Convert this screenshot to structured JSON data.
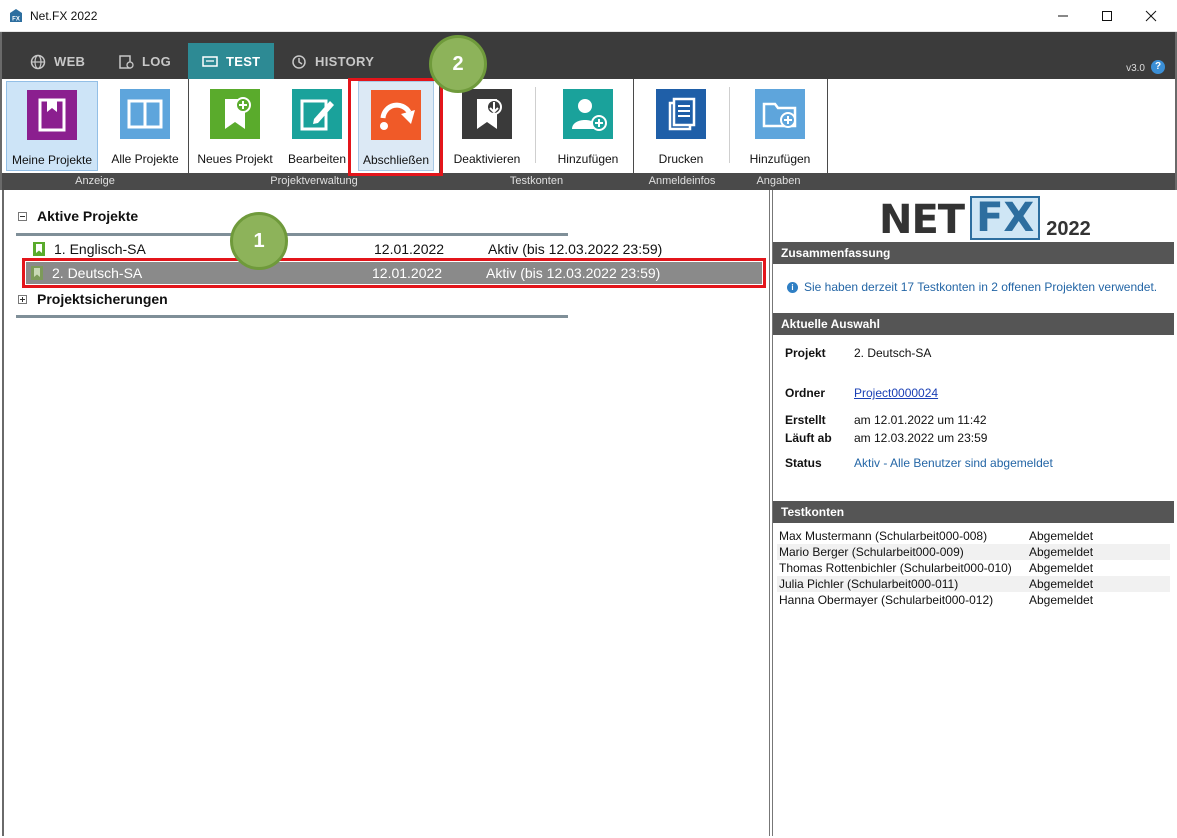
{
  "window": {
    "title": "Net.FX 2022",
    "app_icon_letters": "FX"
  },
  "tabs": [
    {
      "label": "WEB",
      "icon": "globe-icon"
    },
    {
      "label": "LOG",
      "icon": "log-icon"
    },
    {
      "label": "TEST",
      "icon": "test-icon",
      "active": true
    },
    {
      "label": "HISTORY",
      "icon": "history-icon"
    }
  ],
  "version": "v3.0",
  "help_glyph": "?",
  "ribbon": {
    "buttons": [
      {
        "label": "Meine Projekte",
        "icon": "my-projects-icon",
        "color": "#8b1f8f",
        "selected": true
      },
      {
        "label": "Alle Projekte",
        "icon": "all-projects-icon",
        "color": "#5ea5dc"
      },
      {
        "label": "Neues Projekt",
        "icon": "new-project-icon",
        "color": "#5aab2c"
      },
      {
        "label": "Bearbeiten",
        "icon": "edit-icon",
        "color": "#1aa29b"
      },
      {
        "label": "Abschließen",
        "icon": "finish-icon",
        "color": "#f05a28",
        "highlighted": true
      },
      {
        "label": "Deaktivieren",
        "icon": "deactivate-icon",
        "color": "#3a3a3a"
      },
      {
        "label": "Hinzufügen",
        "icon": "add-user-icon",
        "color": "#1aa29b"
      },
      {
        "label": "Drucken",
        "icon": "print-icon",
        "color": "#1f5fa8"
      },
      {
        "label": "Hinzufügen",
        "icon": "add-folder-icon",
        "color": "#5ea5dc"
      }
    ],
    "groups": [
      "Anzeige",
      "Projektverwaltung",
      "Testkonten",
      "Anmeldeinfos",
      "Angaben"
    ]
  },
  "tree": {
    "active_header": "Aktive Projekte",
    "backup_header": "Projektsicherungen",
    "projects": [
      {
        "name": "1. Englisch-SA",
        "date": "12.01.2022",
        "status": "Aktiv (bis 12.03.2022 23:59)",
        "selected": false
      },
      {
        "name": "2. Deutsch-SA",
        "date": "12.01.2022",
        "status": "Aktiv (bis 12.03.2022 23:59)",
        "selected": true
      }
    ]
  },
  "callouts": [
    "1",
    "2"
  ],
  "right": {
    "logo": {
      "net": "NET",
      "fx": "FX",
      "year": "2022"
    },
    "summary_header": "Zusammenfassung",
    "summary_text": "Sie haben derzeit 17 Testkonten in 2 offenen Projekten verwendet.",
    "info_glyph": "i",
    "selection_header": "Aktuelle Auswahl",
    "selection": {
      "projekt_label": "Projekt",
      "projekt_value": "2. Deutsch-SA",
      "ordner_label": "Ordner",
      "ordner_value": "Project0000024",
      "erstellt_label": "Erstellt",
      "erstellt_value": "am 12.01.2022 um 11:42",
      "laeuft_label": "Läuft ab",
      "laeuft_value": "am 12.03.2022 um 23:59",
      "status_label": "Status",
      "status_value": "Aktiv - Alle Benutzer sind abgemeldet"
    },
    "accounts_header": "Testkonten",
    "accounts": [
      {
        "name": "Max Mustermann (Schularbeit000-008)",
        "status": "Abgemeldet"
      },
      {
        "name": "Mario Berger (Schularbeit000-009)",
        "status": "Abgemeldet"
      },
      {
        "name": "Thomas Rottenbichler (Schularbeit000-010)",
        "status": "Abgemeldet"
      },
      {
        "name": "Julia Pichler (Schularbeit000-011)",
        "status": "Abgemeldet"
      },
      {
        "name": "Hanna Obermayer (Schularbeit000-012)",
        "status": "Abgemeldet"
      }
    ]
  }
}
